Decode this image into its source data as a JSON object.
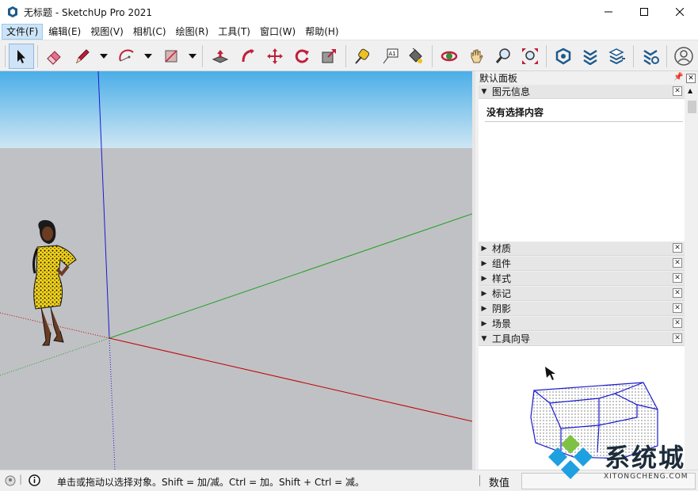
{
  "window": {
    "title": "无标题 - SketchUp Pro 2021"
  },
  "menu": {
    "items": [
      "文件(F)",
      "编辑(E)",
      "视图(V)",
      "相机(C)",
      "绘图(R)",
      "工具(T)",
      "窗口(W)",
      "帮助(H)"
    ],
    "active_index": 0
  },
  "toolbar": {
    "tools": [
      "select-tool",
      "eraser-tool",
      "line-tool",
      "arc-tool",
      "rectangle-tool",
      "push-pull-tool",
      "follow-me-tool",
      "move-tool",
      "rotate-tool",
      "scale-tool",
      "tape-measure-tool",
      "text-tool",
      "paint-bucket-tool",
      "orbit-tool",
      "pan-tool",
      "zoom-tool",
      "zoom-extents-tool",
      "warehouse-tool",
      "extension-warehouse-tool",
      "layout-tool",
      "extension-manager-tool",
      "profile-tool"
    ],
    "text_tool_label": "A1"
  },
  "tray": {
    "title": "默认面板",
    "entity_info": {
      "title": "图元信息",
      "message": "没有选择内容"
    },
    "panels": [
      "材质",
      "组件",
      "样式",
      "标记",
      "阴影",
      "场景"
    ],
    "instructor": {
      "title": "工具向导"
    }
  },
  "status": {
    "text": "单击或拖动以选择对象。Shift = 加/减。Ctrl = 加。Shift + Ctrl = 减。",
    "measurements_label": "数值",
    "measurements_value": ""
  },
  "watermark": {
    "text": "系统城",
    "sub": "XITONGCHENG.COM"
  },
  "colors": {
    "sky_top": "#4aaee8",
    "sky_bottom": "#cfe6f3",
    "ground": "#c0c1c5",
    "axis_red": "#c00000",
    "axis_green": "#1fa01f",
    "axis_blue": "#1a1ad0"
  }
}
